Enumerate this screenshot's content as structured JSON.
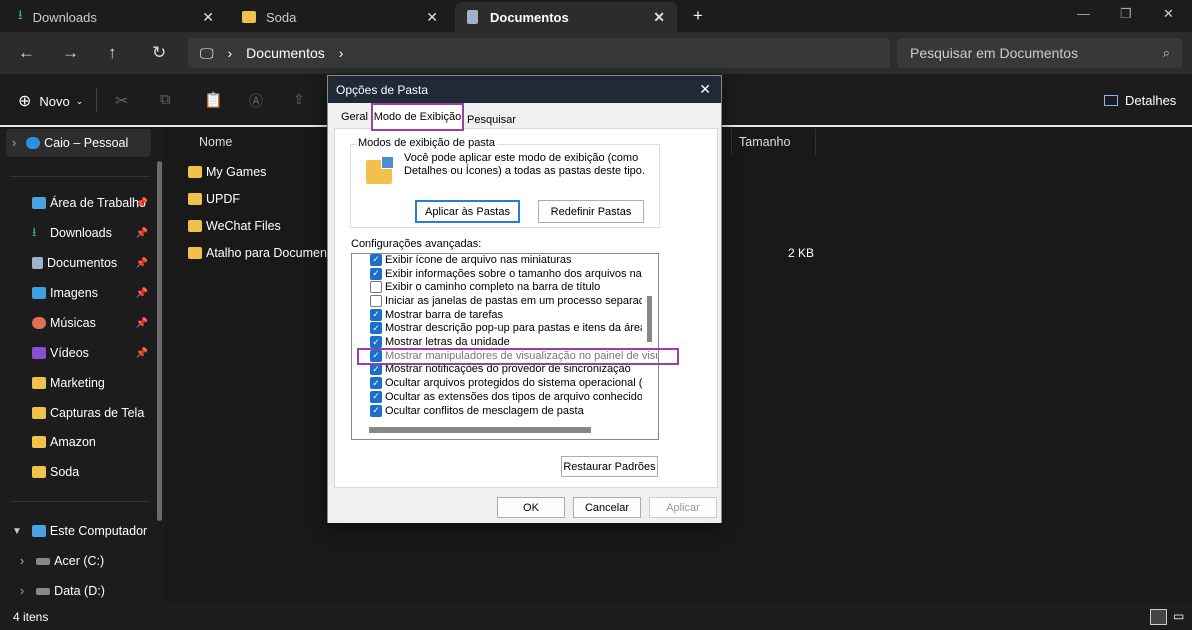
{
  "tabs": [
    {
      "label": "Downloads",
      "icon": "download-icon"
    },
    {
      "label": "Soda",
      "icon": "folder-icon"
    },
    {
      "label": "Documentos",
      "icon": "document-icon",
      "active": true
    }
  ],
  "address": {
    "segment": "Documentos"
  },
  "search": {
    "placeholder": "Pesquisar em Documentos"
  },
  "toolbar": {
    "new_label": "Novo",
    "details_label": "Detalhes"
  },
  "sidebar": {
    "account": "Caio – Pessoal",
    "items": [
      {
        "label": "Área de Trabalho",
        "pinned": true
      },
      {
        "label": "Downloads",
        "pinned": true
      },
      {
        "label": "Documentos",
        "pinned": true
      },
      {
        "label": "Imagens",
        "pinned": true
      },
      {
        "label": "Músicas",
        "pinned": true
      },
      {
        "label": "Vídeos",
        "pinned": true
      },
      {
        "label": "Marketing"
      },
      {
        "label": "Capturas de Tela"
      },
      {
        "label": "Amazon"
      },
      {
        "label": "Soda"
      }
    ],
    "computer": "Este Computador",
    "drives": [
      "Acer (C:)",
      "Data (D:)"
    ]
  },
  "columns": {
    "name": "Nome",
    "size": "Tamanho"
  },
  "files": [
    {
      "name": "My Games",
      "size": ""
    },
    {
      "name": "UPDF",
      "size": ""
    },
    {
      "name": "WeChat Files",
      "size": ""
    },
    {
      "name": "Atalho para Documentos",
      "size": "2 KB"
    }
  ],
  "status": {
    "count": "4 itens"
  },
  "dialog": {
    "title": "Opções de Pasta",
    "tabs": [
      "Geral",
      "Modo de Exibição",
      "Pesquisar"
    ],
    "group_title": "Modos de exibição de pasta",
    "group_text": "Você pode aplicar este modo de exibição (como Detalhes ou Ícones) a todas as pastas deste tipo.",
    "apply_folders": "Aplicar às Pastas",
    "reset_folders": "Redefinir Pastas",
    "advanced_label": "Configurações avançadas:",
    "options": [
      {
        "label": "Exibir ícone de arquivo nas miniaturas",
        "checked": true
      },
      {
        "label": "Exibir informações sobre o tamanho dos arquivos nas dicas",
        "checked": true
      },
      {
        "label": "Exibir o caminho completo na barra de título",
        "checked": false
      },
      {
        "label": "Iniciar as janelas de pastas em um processo separado",
        "checked": false
      },
      {
        "label": "Mostrar barra de tarefas",
        "checked": true
      },
      {
        "label": "Mostrar descrição pop-up para pastas e itens da área de tr",
        "checked": true
      },
      {
        "label": "Mostrar letras da unidade",
        "checked": true
      },
      {
        "label": "Mostrar manipuladores de visualização no painel de visualização",
        "checked": true,
        "highlighted": true
      },
      {
        "label": "Mostrar notificações do provedor de sincronização",
        "checked": true
      },
      {
        "label": "Ocultar arquivos protegidos do sistema operacional (Recon",
        "checked": true
      },
      {
        "label": "Ocultar as extensões dos tipos de arquivo conhecidos",
        "checked": true
      },
      {
        "label": "Ocultar conflitos de mesclagem de pasta",
        "checked": true
      }
    ],
    "restore": "Restaurar Padrões",
    "ok": "OK",
    "cancel": "Cancelar",
    "apply": "Aplicar",
    "highlight_color": "#9b3fa8"
  }
}
